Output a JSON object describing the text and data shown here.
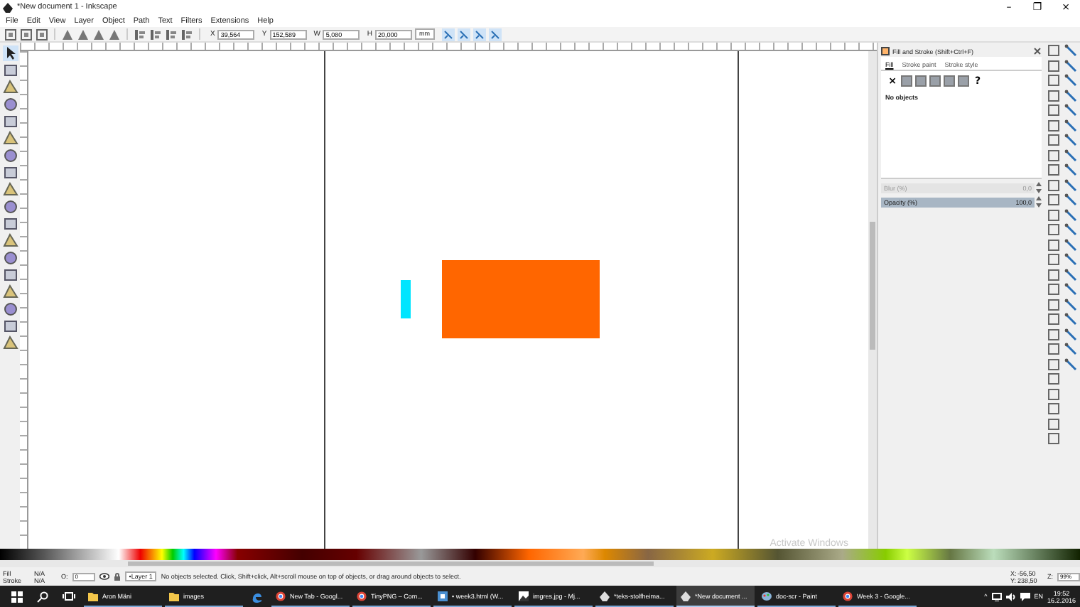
{
  "window": {
    "title": "*New document 1 - Inkscape",
    "controls": [
      "–",
      "❐",
      "×"
    ]
  },
  "menu": [
    "File",
    "Edit",
    "View",
    "Layer",
    "Object",
    "Path",
    "Text",
    "Filters",
    "Extensions",
    "Help"
  ],
  "toolbar": {
    "fields": [
      {
        "label": "X",
        "value": "39,564"
      },
      {
        "label": "Y",
        "value": "152,589"
      },
      {
        "label": "W",
        "value": "5,080"
      },
      {
        "label": "H",
        "value": "20,000"
      }
    ],
    "unit": "mm"
  },
  "canvas": {
    "objects": [
      {
        "kind": "rect",
        "color": "#00e5ff"
      },
      {
        "kind": "rect",
        "color": "#ff6600"
      }
    ]
  },
  "dock": {
    "title": "Fill and Stroke (Shift+Ctrl+F)",
    "tabs": [
      {
        "label": "Fill",
        "selected": true
      },
      {
        "label": "Stroke paint",
        "selected": false
      },
      {
        "label": "Stroke style",
        "selected": false
      }
    ],
    "paint_none": "×",
    "paint_unset": "?",
    "message": "No objects",
    "sliders": [
      {
        "label": "Blur (%)",
        "value": "0,0",
        "level": 0,
        "disabled": true
      },
      {
        "label": "Opacity (%)",
        "value": "100,0",
        "level": 1,
        "disabled": false
      }
    ]
  },
  "watermark_text": "Activate Windows",
  "status_bar": {
    "fill_label": "Fill",
    "fill_value": "N/A",
    "stroke_label": "Stroke",
    "stroke_value": "N/A",
    "opacity_label": "O:",
    "opacity_value": "0",
    "layer": "•Layer 1",
    "message": "No objects selected. Click, Shift+click, Alt+scroll mouse on top of objects, or drag around objects to select.",
    "x_label": "X:",
    "x_value": "-56,50",
    "y_label": "Y:",
    "y_value": "238,50",
    "zoom_label": "Z:",
    "zoom_value": "99%"
  },
  "taskbar": {
    "items": [
      {
        "label": "Aron Mäni",
        "kind": "folder",
        "selected": false
      },
      {
        "label": "images",
        "kind": "folder",
        "selected": false
      },
      {
        "label": "New Tab - Googl...",
        "kind": "browser",
        "selected": false
      },
      {
        "label": "TinyPNG – Com...",
        "kind": "browser",
        "selected": false
      },
      {
        "label": "• week3.html (W...",
        "kind": "editor",
        "selected": false
      },
      {
        "label": "imgres.jpg - Mj...",
        "kind": "image",
        "selected": false
      },
      {
        "label": "*teks-stolfheima...",
        "kind": "inkscape",
        "selected": false
      },
      {
        "label": "*New document ...",
        "kind": "inkscape",
        "selected": true
      },
      {
        "label": "doc-scr - Paint",
        "kind": "paint",
        "selected": false
      },
      {
        "label": "Week 3 - Google...",
        "kind": "browser",
        "selected": false
      }
    ],
    "tray": {
      "chevron": "^",
      "language": "EN",
      "time": "19:52",
      "date": "16.2.2016"
    }
  }
}
